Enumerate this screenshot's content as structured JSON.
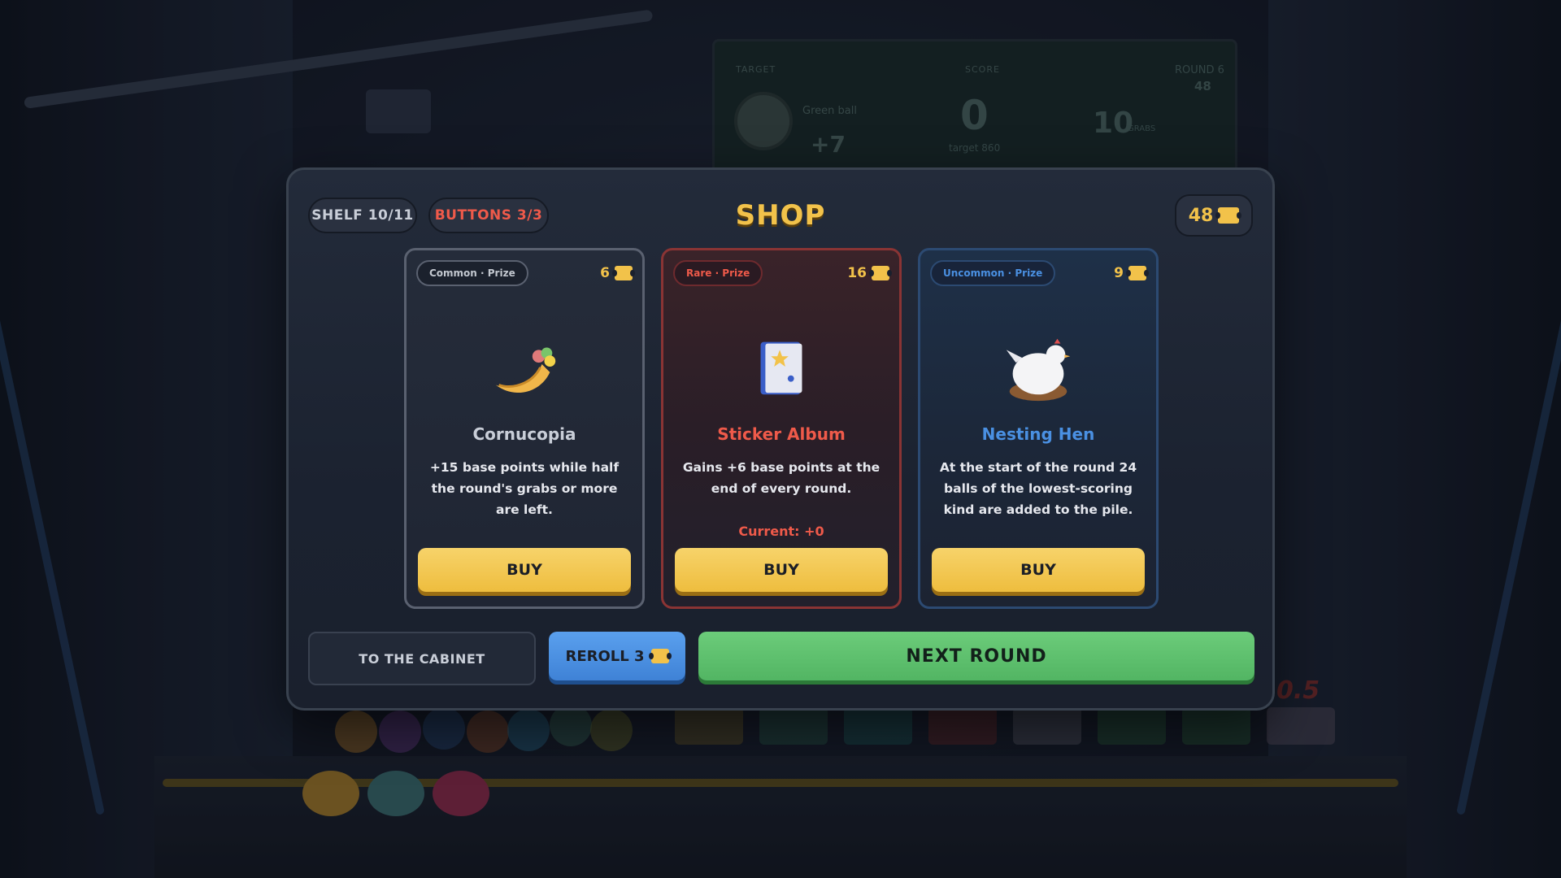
{
  "scoreboard": {
    "target_label": "TARGET",
    "score_label": "SCORE",
    "round_label": "ROUND 6",
    "round_tickets": "48",
    "target_ball": "Green ball",
    "target_points": "+7",
    "score": "0",
    "score_target": "target 860",
    "grabs": "10",
    "grabs_label": "GRABS",
    "multiplier": "0.5"
  },
  "shop": {
    "title": "SHOP",
    "shelf": "SHELF 10/11",
    "buttons": "BUTTONS 3/3",
    "tickets": "48",
    "colors": {
      "gold": "#f2c24a",
      "rare": "#ef5a4a",
      "uncommon": "#4a90e2",
      "next": "#52b563",
      "reroll": "#3f82d6"
    },
    "items": [
      {
        "rarity": "Common · Prize",
        "price": "6",
        "icon": "cornucopia-icon",
        "name": "Cornucopia",
        "description": "+15 base points while half the round's grabs or more are left.",
        "current": "",
        "buy_label": "BUY"
      },
      {
        "rarity": "Rare · Prize",
        "price": "16",
        "icon": "sticker-album-icon",
        "name": "Sticker Album",
        "description": "Gains +6 base points at the end of every round.",
        "current": "Current: +0",
        "buy_label": "BUY"
      },
      {
        "rarity": "Uncommon · Prize",
        "price": "9",
        "icon": "nesting-hen-icon",
        "name": "Nesting Hen",
        "description": "At the start of the round 24 balls of the lowest-scoring kind are added to the pile.",
        "current": "",
        "buy_label": "BUY"
      }
    ],
    "to_cabinet": "TO THE CABINET",
    "reroll": "REROLL 3",
    "next_round": "NEXT ROUND"
  }
}
